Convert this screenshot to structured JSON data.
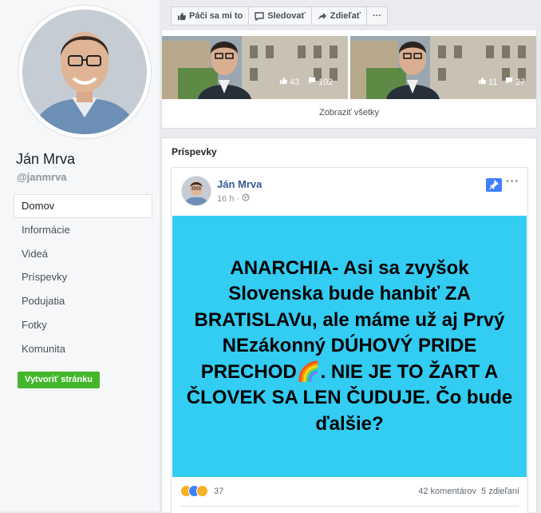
{
  "profile": {
    "name": "Ján Mrva",
    "handle": "@janmrva"
  },
  "nav": {
    "items": [
      "Domov",
      "Informácie",
      "Videá",
      "Príspevky",
      "Podujatia",
      "Fotky",
      "Komunita"
    ],
    "active_index": 0
  },
  "create_page_label": "Vytvoriť stránku",
  "actions": {
    "like": "Páči sa mi to",
    "follow": "Sledovať",
    "share": "Zdieľať",
    "more": "···"
  },
  "videos": {
    "items": [
      {
        "likes": "43",
        "comments": "102"
      },
      {
        "likes": "11",
        "comments": "27"
      }
    ],
    "show_all": "Zobraziť všetky"
  },
  "posts": {
    "title": "Príspevky",
    "post": {
      "author": "Ján Mrva",
      "time": "16 h ·",
      "more": "···",
      "image_text": "ANARCHIA- Asi sa zvyšok Slovenska bude hanbiť ZA BRATISLAVu, ale máme už aj Prvý NEzákonný DÚHOVÝ PRIDE PRECHOD🌈. NIE JE TO ŽART A ČLOVEK SA LEN ČUDUJE. Čo bude ďalšie?",
      "reaction_count": "37",
      "comments": "42 komentárov",
      "shares": "5 zdieľaní"
    }
  },
  "colors": {
    "image_bg": "#33ccf2",
    "link": "#365899",
    "create_btn": "#42b72a",
    "pin": "#4080ff"
  }
}
